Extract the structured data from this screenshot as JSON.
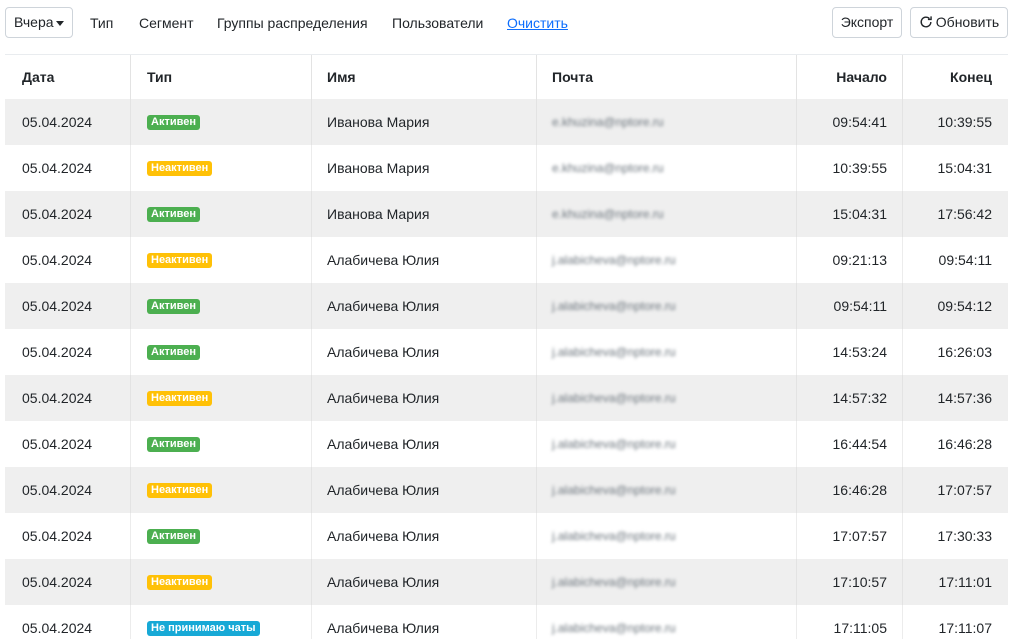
{
  "toolbar": {
    "period": "Вчера",
    "filters": [
      "Тип",
      "Сегмент",
      "Группы распределения",
      "Пользователи"
    ],
    "clear": "Очистить",
    "export": "Экспорт",
    "refresh": "Обновить"
  },
  "table": {
    "headers": {
      "date": "Дата",
      "type": "Тип",
      "name": "Имя",
      "email": "Почта",
      "start": "Начало",
      "end": "Конец"
    },
    "rows": [
      {
        "date": "05.04.2024",
        "status": "Активен",
        "status_kind": "active",
        "name": "Иванова Мария",
        "email": "e.khuzina@nptore.ru",
        "start": "09:54:41",
        "end": "10:39:55"
      },
      {
        "date": "05.04.2024",
        "status": "Неактивен",
        "status_kind": "inactive",
        "name": "Иванова Мария",
        "email": "e.khuzina@nptore.ru",
        "start": "10:39:55",
        "end": "15:04:31"
      },
      {
        "date": "05.04.2024",
        "status": "Активен",
        "status_kind": "active",
        "name": "Иванова Мария",
        "email": "e.khuzina@nptore.ru",
        "start": "15:04:31",
        "end": "17:56:42"
      },
      {
        "date": "05.04.2024",
        "status": "Неактивен",
        "status_kind": "inactive",
        "name": "Алабичева Юлия",
        "email": "j.alabicheva@nptore.ru",
        "start": "09:21:13",
        "end": "09:54:11"
      },
      {
        "date": "05.04.2024",
        "status": "Активен",
        "status_kind": "active",
        "name": "Алабичева Юлия",
        "email": "j.alabicheva@nptore.ru",
        "start": "09:54:11",
        "end": "09:54:12"
      },
      {
        "date": "05.04.2024",
        "status": "Активен",
        "status_kind": "active",
        "name": "Алабичева Юлия",
        "email": "j.alabicheva@nptore.ru",
        "start": "14:53:24",
        "end": "16:26:03"
      },
      {
        "date": "05.04.2024",
        "status": "Неактивен",
        "status_kind": "inactive",
        "name": "Алабичева Юлия",
        "email": "j.alabicheva@nptore.ru",
        "start": "14:57:32",
        "end": "14:57:36"
      },
      {
        "date": "05.04.2024",
        "status": "Активен",
        "status_kind": "active",
        "name": "Алабичева Юлия",
        "email": "j.alabicheva@nptore.ru",
        "start": "16:44:54",
        "end": "16:46:28"
      },
      {
        "date": "05.04.2024",
        "status": "Неактивен",
        "status_kind": "inactive",
        "name": "Алабичева Юлия",
        "email": "j.alabicheva@nptore.ru",
        "start": "16:46:28",
        "end": "17:07:57"
      },
      {
        "date": "05.04.2024",
        "status": "Активен",
        "status_kind": "active",
        "name": "Алабичева Юлия",
        "email": "j.alabicheva@nptore.ru",
        "start": "17:07:57",
        "end": "17:30:33"
      },
      {
        "date": "05.04.2024",
        "status": "Неактивен",
        "status_kind": "inactive",
        "name": "Алабичева Юлия",
        "email": "j.alabicheva@nptore.ru",
        "start": "17:10:57",
        "end": "17:11:01"
      },
      {
        "date": "05.04.2024",
        "status": "Не принимаю чаты",
        "status_kind": "nochat",
        "name": "Алабичева Юлия",
        "email": "j.alabicheva@nptore.ru",
        "start": "17:11:05",
        "end": "17:11:07"
      }
    ]
  },
  "colors": {
    "active": "#4caf50",
    "inactive": "#ffc107",
    "nochat": "#17a9d6",
    "link": "#0d6efd",
    "row_stripe": "#efefef"
  },
  "icons": {
    "refresh": "refresh-icon",
    "caret": "caret-down-icon"
  }
}
